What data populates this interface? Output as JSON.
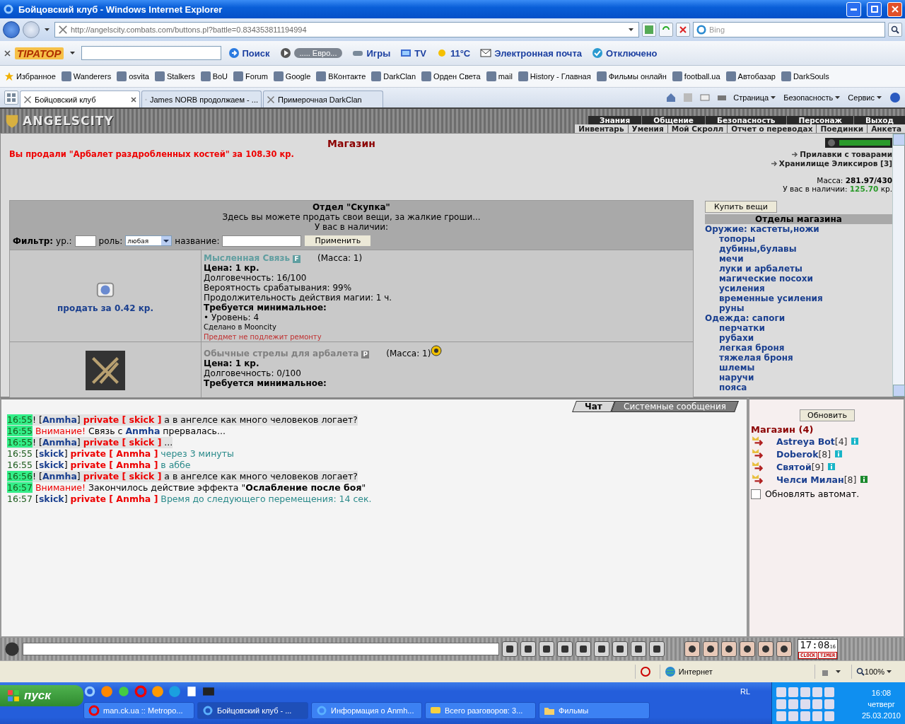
{
  "window": {
    "title": "Бойцовский клуб - Windows Internet Explorer"
  },
  "address_bar": {
    "url": "http://angelscity.combats.com/buttons.pl?battle=0.834353811194994",
    "search_placeholder": "Bing"
  },
  "toolbar": {
    "brand": "TIPATOP",
    "items": [
      {
        "kind": "search",
        "label": "Поиск"
      },
      {
        "kind": "media",
        "label": "..... Евро..."
      },
      {
        "kind": "games",
        "label": "Игры"
      },
      {
        "kind": "tv",
        "label": "TV"
      },
      {
        "kind": "weather",
        "label": "11°C"
      },
      {
        "kind": "mail",
        "label": "Электронная почта"
      },
      {
        "kind": "status",
        "label": "Отключено"
      }
    ]
  },
  "favorites": {
    "title": "Избранное",
    "items": [
      "Wanderers",
      "osvita",
      "Stalkers",
      "BoU",
      "Forum",
      "Google",
      "ВКонтакте",
      "DarkClan",
      "Орден Света",
      "mail",
      "History - Главная",
      "Фильмы онлайн",
      "football.ua",
      "Автобазар",
      "DarkSouls"
    ]
  },
  "tabs": [
    {
      "label": "Бойцовский клуб",
      "selected": true
    },
    {
      "label": "James NORB продолжаем - ...",
      "selected": false
    },
    {
      "label": "Примерочная DarkClan",
      "selected": false
    }
  ],
  "command_bar": [
    "Страница",
    "Безопасность",
    "Сервис"
  ],
  "game": {
    "logo": "ANGELSCITY",
    "menu_top": [
      "Знания",
      "Общение",
      "Безопасность",
      "Персонаж",
      "Выход"
    ],
    "menu_bottom": [
      "Инвентарь",
      "Умения",
      "Мой Скролл",
      "Отчет о переводах",
      "Поединки",
      "Анкета"
    ]
  },
  "shop": {
    "title": "Магазин",
    "message": "Вы продали \"Арбалет раздробленных костей\" за 108.30 кр.",
    "links": [
      "Прилавки с товарами",
      "Хранилище Эликсиров [3]"
    ],
    "mass_label": "Масса:",
    "mass_value": "281.97/430",
    "money_label": "У вас в наличии:",
    "money_value": "125.70",
    "money_unit": "кр.",
    "section_title": "Отдел \"Скупка\"",
    "section_desc": "Здесь вы можете продать свои вещи, за жалкие гроши...",
    "section_money": "У вас в наличии:",
    "filter": {
      "label": "Фильтр:",
      "level_label": "ур.:",
      "role_label": "роль:",
      "role_value": "любая",
      "name_label": "название:",
      "apply": "Применить"
    },
    "items": [
      {
        "name": "Мысленная Связь",
        "tag": "F",
        "color": "#5f9ea0",
        "mass": "(Масса: 1)",
        "badge": false,
        "sell": "продать за 0.42 кр.",
        "lines": [
          {
            "kind": "bold",
            "text": "Цена: 1 кр."
          },
          {
            "kind": "text",
            "text": "Долговечность: 16/100"
          },
          {
            "kind": "text",
            "text": "Вероятность срабатывания: 99%"
          },
          {
            "kind": "text",
            "text": "Продолжительность действия магии: 1 ч."
          },
          {
            "kind": "bold",
            "text": "Требуется минимальное:"
          },
          {
            "kind": "text",
            "text": "• Уровень: 4"
          },
          {
            "kind": "small",
            "text": "Сделано в Mooncity"
          },
          {
            "kind": "note",
            "text": "Предмет не подлежит ремонту"
          }
        ]
      },
      {
        "name": "Обычные стрелы для арбалета",
        "tag": "P",
        "color": "#808080",
        "mass": "(Масса: 1)",
        "badge": true,
        "lines": [
          {
            "kind": "bold",
            "text": "Цена: 1 кр."
          },
          {
            "kind": "text",
            "text": "Долговечность: 0/100"
          },
          {
            "kind": "bold",
            "text": "Требуется минимальное:"
          }
        ]
      }
    ],
    "buy_button": "Купить вещи",
    "departments_title": "Отделы магазина",
    "departments": [
      {
        "label": "Оружие: кастеты,ножи",
        "children": [
          {
            "label": "топоры"
          },
          {
            "label": "дубины,булавы"
          },
          {
            "label": "мечи"
          },
          {
            "label": "луки и арбалеты"
          },
          {
            "label": "магические посохи"
          },
          {
            "label": "усиления"
          },
          {
            "label": "временные усиления"
          },
          {
            "label": "руны"
          }
        ]
      },
      {
        "label": "Одежда: сапоги",
        "children": [
          {
            "label": "перчатки"
          },
          {
            "label": "рубахи"
          },
          {
            "label": "легкая броня"
          },
          {
            "label": "тяжелая броня"
          },
          {
            "label": "шлемы"
          },
          {
            "label": "наручи"
          },
          {
            "label": "пояса"
          }
        ]
      }
    ]
  },
  "chat": {
    "tabs": [
      {
        "label": "Чат",
        "selected": true
      },
      {
        "label": "Системные сообщения",
        "selected": false
      }
    ],
    "messages": [
      {
        "time": "16:55",
        "marked": true,
        "shaded": true,
        "parts": [
          {
            "kind": "plain",
            "text": "! ["
          },
          {
            "kind": "nick",
            "text": "Anmha"
          },
          {
            "kind": "plain",
            "text": "] "
          },
          {
            "kind": "private",
            "text": "private [ skick ]"
          },
          {
            "kind": "plain",
            "text": " а в ангелсе как много человеков логает?"
          }
        ]
      },
      {
        "time": "16:55",
        "marked": true,
        "shaded": false,
        "parts": [
          {
            "kind": "warning",
            "text": " Внимание!"
          },
          {
            "kind": "plain",
            "text": " Связь с "
          },
          {
            "kind": "nick",
            "text": "Anmha"
          },
          {
            "kind": "plain",
            "text": " прервалась..."
          }
        ]
      },
      {
        "time": "16:55",
        "marked": true,
        "shaded": true,
        "parts": [
          {
            "kind": "plain",
            "text": "! ["
          },
          {
            "kind": "nick",
            "text": "Anmha"
          },
          {
            "kind": "plain",
            "text": "] "
          },
          {
            "kind": "private",
            "text": "private [ skick ]"
          },
          {
            "kind": "plain",
            "text": " ..."
          }
        ]
      },
      {
        "time": "16:55",
        "marked": false,
        "shaded": false,
        "parts": [
          {
            "kind": "plain",
            "text": " ["
          },
          {
            "kind": "nick",
            "text": "skick"
          },
          {
            "kind": "plain",
            "text": "] "
          },
          {
            "kind": "private",
            "text": "private [ Anmha ]"
          },
          {
            "kind": "reply",
            "text": " через 3 минуты"
          }
        ]
      },
      {
        "time": "16:55",
        "marked": false,
        "shaded": false,
        "parts": [
          {
            "kind": "plain",
            "text": " ["
          },
          {
            "kind": "nick",
            "text": "skick"
          },
          {
            "kind": "plain",
            "text": "] "
          },
          {
            "kind": "private",
            "text": "private [ Anmha ]"
          },
          {
            "kind": "reply",
            "text": " в аббе"
          }
        ]
      },
      {
        "time": "16:56",
        "marked": true,
        "shaded": true,
        "parts": [
          {
            "kind": "plain",
            "text": "! ["
          },
          {
            "kind": "nick",
            "text": "Anmha"
          },
          {
            "kind": "plain",
            "text": "] "
          },
          {
            "kind": "private",
            "text": "private [ skick ]"
          },
          {
            "kind": "plain",
            "text": " а в ангелсе как много человеков логает?"
          }
        ]
      },
      {
        "time": "16:57",
        "marked": true,
        "shaded": false,
        "parts": [
          {
            "kind": "warning",
            "text": " Внимание!"
          },
          {
            "kind": "plain",
            "text": " Закончилось действие эффекта \""
          },
          {
            "kind": "bold",
            "text": "Ослабление после боя"
          },
          {
            "kind": "plain",
            "text": "\""
          }
        ]
      },
      {
        "time": "16:57",
        "marked": false,
        "shaded": false,
        "parts": [
          {
            "kind": "plain",
            "text": " ["
          },
          {
            "kind": "nick",
            "text": "skick"
          },
          {
            "kind": "plain",
            "text": "] "
          },
          {
            "kind": "private",
            "text": "private [ Anmha ]"
          },
          {
            "kind": "reply",
            "text": " Время до следующего перемещения: 14 сек."
          }
        ]
      }
    ]
  },
  "online": {
    "refresh": "Обновить",
    "title": "Магазин (4)",
    "users": [
      {
        "name": "Astreya Bot",
        "level": "[4]",
        "color": "#19b5c8"
      },
      {
        "name": "Doberok",
        "level": "[8]",
        "color": "#19b5c8"
      },
      {
        "name": "Святой",
        "level": "[9]",
        "color": "#19b5c8"
      },
      {
        "name": "Челси Милан",
        "level": "[8]",
        "color": "#1c8a2e"
      }
    ],
    "auto_refresh": {
      "label": "Обновлять автомат.",
      "checked": false
    }
  },
  "game_clock": {
    "time": "17:08",
    "seconds": "16",
    "clock_label": "CLOCK",
    "timer_label": "TIMER"
  },
  "status_bar": {
    "zone": "Интернет",
    "zoom": "100%"
  },
  "taskbar": {
    "start": "пуск",
    "language": "RL",
    "tasks": [
      {
        "label": "man.ck.ua :: Metropo...",
        "selected": false
      },
      {
        "label": "Бойцовский клуб - ...",
        "selected": true
      },
      {
        "label": "Информация о Anmh...",
        "selected": false
      },
      {
        "label": "Всего разговоров: 3...",
        "selected": false
      },
      {
        "label": "Фильмы",
        "selected": false
      }
    ],
    "clock": {
      "time": "16:08",
      "day": "четверг",
      "date": "25.03.2010"
    }
  }
}
